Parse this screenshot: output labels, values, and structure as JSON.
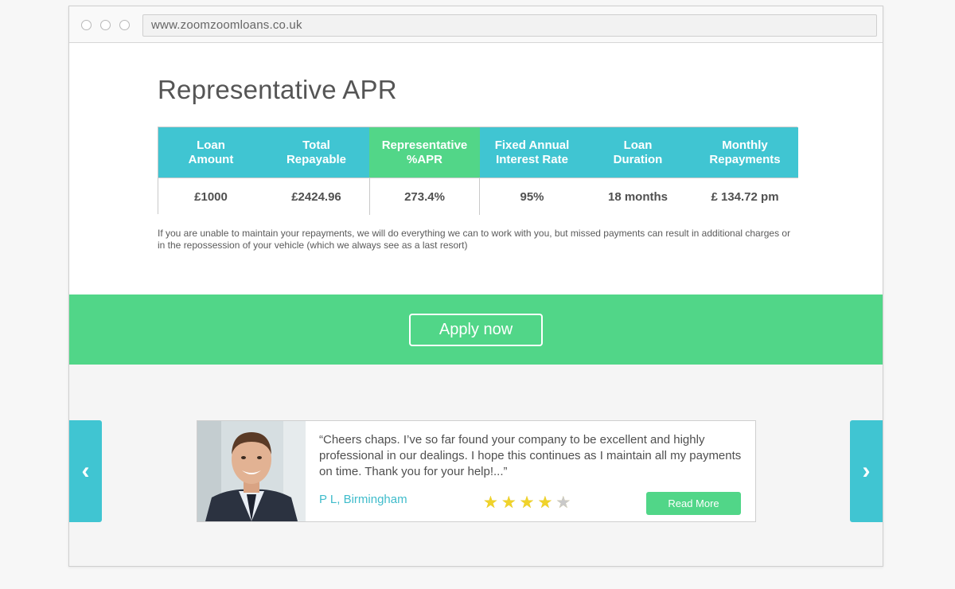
{
  "browser": {
    "url": "www.zoomzoomloans.co.uk"
  },
  "page": {
    "title": "Representative APR"
  },
  "apr_table": {
    "headers": [
      "Loan\nAmount",
      "Total\nRepayable",
      "Representative\n%APR",
      "Fixed Annual\nInterest Rate",
      "Loan\nDuration",
      "Monthly\nRepayments"
    ],
    "values": [
      "£1000",
      "£2424.96",
      "273.4%",
      "95%",
      "18 months",
      "£ 134.72 pm"
    ],
    "highlight_color": "#52d688",
    "header_color": "#40c5d2"
  },
  "disclaimer": "If you are unable to maintain your repayments, we will do everything we can to work with you, but missed payments can result in additional charges or in the repossession of your vehicle (which we always see as a last resort)",
  "apply": {
    "label": "Apply now",
    "band_color": "#51d688"
  },
  "testimonial": {
    "quote": "“Cheers chaps. I’ve so far found your company to be excellent and highly professional in our dealings. I hope this continues as I maintain all my payments on time. Thank you for your help!...”",
    "author": "P L, Birmingham",
    "rating": 4,
    "rating_max": 5,
    "read_more_label": "Read More",
    "prev_icon": "chevron-left-icon",
    "next_icon": "chevron-right-icon",
    "prev_glyph": "‹",
    "next_glyph": "›"
  }
}
